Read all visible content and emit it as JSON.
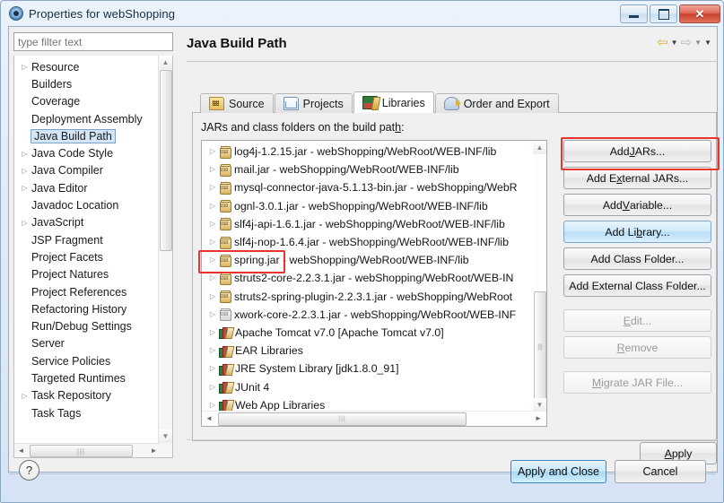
{
  "window": {
    "title": "Properties for webShopping",
    "icon": "properties-gear-icon",
    "controls": {
      "minimize": "minimize",
      "maximize": "maximize",
      "close": "close"
    }
  },
  "filter": {
    "placeholder": "type filter text",
    "value": ""
  },
  "sidebar": {
    "items": [
      {
        "label": "Resource",
        "expandable": true,
        "selected": false
      },
      {
        "label": "Builders",
        "expandable": false,
        "selected": false
      },
      {
        "label": "Coverage",
        "expandable": false,
        "selected": false
      },
      {
        "label": "Deployment Assembly",
        "expandable": false,
        "selected": false
      },
      {
        "label": "Java Build Path",
        "expandable": false,
        "selected": true
      },
      {
        "label": "Java Code Style",
        "expandable": true,
        "selected": false
      },
      {
        "label": "Java Compiler",
        "expandable": true,
        "selected": false
      },
      {
        "label": "Java Editor",
        "expandable": true,
        "selected": false
      },
      {
        "label": "Javadoc Location",
        "expandable": false,
        "selected": false
      },
      {
        "label": "JavaScript",
        "expandable": true,
        "selected": false
      },
      {
        "label": "JSP Fragment",
        "expandable": false,
        "selected": false
      },
      {
        "label": "Project Facets",
        "expandable": false,
        "selected": false
      },
      {
        "label": "Project Natures",
        "expandable": false,
        "selected": false
      },
      {
        "label": "Project References",
        "expandable": false,
        "selected": false
      },
      {
        "label": "Refactoring History",
        "expandable": false,
        "selected": false
      },
      {
        "label": "Run/Debug Settings",
        "expandable": false,
        "selected": false
      },
      {
        "label": "Server",
        "expandable": false,
        "selected": false
      },
      {
        "label": "Service Policies",
        "expandable": false,
        "selected": false
      },
      {
        "label": "Targeted Runtimes",
        "expandable": false,
        "selected": false
      },
      {
        "label": "Task Repository",
        "expandable": true,
        "selected": false
      },
      {
        "label": "Task Tags",
        "expandable": false,
        "selected": false
      }
    ]
  },
  "page": {
    "title": "Java Build Path",
    "nav": {
      "back_icon": "back-arrow-icon",
      "forward_icon": "forward-arrow-icon",
      "menu_icon": "chevron-down-icon"
    }
  },
  "tabs": [
    {
      "label": "Source",
      "icon": "source-folder-icon",
      "active": false
    },
    {
      "label": "Projects",
      "icon": "projects-folder-icon",
      "active": false
    },
    {
      "label": "Libraries",
      "icon": "libraries-books-icon",
      "active": true
    },
    {
      "label": "Order and Export",
      "icon": "order-export-icon",
      "active": false
    }
  ],
  "libraries": {
    "list_label_pre": "JARs and class folders on the build pat",
    "list_label_mnemonic": "h",
    "list_label_post": ":",
    "entries": [
      {
        "label": "log4j-1.2.15.jar - webShopping/WebRoot/WEB-INF/lib",
        "icon": "jar-icon",
        "highlighted": false
      },
      {
        "label": "mail.jar - webShopping/WebRoot/WEB-INF/lib",
        "icon": "jar-icon",
        "highlighted": false
      },
      {
        "label": "mysql-connector-java-5.1.13-bin.jar - webShopping/WebR",
        "icon": "jar-icon",
        "highlighted": false
      },
      {
        "label": "ognl-3.0.1.jar - webShopping/WebRoot/WEB-INF/lib",
        "icon": "jar-icon",
        "highlighted": false
      },
      {
        "label": "slf4j-api-1.6.1.jar - webShopping/WebRoot/WEB-INF/lib",
        "icon": "jar-icon",
        "highlighted": false
      },
      {
        "label": "slf4j-nop-1.6.4.jar - webShopping/WebRoot/WEB-INF/lib",
        "icon": "jar-icon",
        "highlighted": false
      },
      {
        "label": "spring.jar - webShopping/WebRoot/WEB-INF/lib",
        "icon": "jar-icon",
        "highlighted": true
      },
      {
        "label": "struts2-core-2.2.3.1.jar - webShopping/WebRoot/WEB-IN",
        "icon": "jar-icon",
        "highlighted": false
      },
      {
        "label": "struts2-spring-plugin-2.2.3.1.jar - webShopping/WebRoot",
        "icon": "jar-icon",
        "highlighted": false
      },
      {
        "label": "xwork-core-2.2.3.1.jar - webShopping/WebRoot/WEB-INF",
        "icon": "jar-icon-grey",
        "highlighted": false
      },
      {
        "label": "Apache Tomcat v7.0 [Apache Tomcat v7.0]",
        "icon": "library-icon",
        "highlighted": false
      },
      {
        "label": "EAR Libraries",
        "icon": "library-icon",
        "highlighted": false
      },
      {
        "label": "JRE System Library [jdk1.8.0_91]",
        "icon": "library-icon",
        "highlighted": false
      },
      {
        "label": "JUnit 4",
        "icon": "library-icon",
        "highlighted": false
      },
      {
        "label": "Web App Libraries",
        "icon": "library-icon",
        "highlighted": false
      }
    ]
  },
  "buttons": [
    {
      "pre": "Add ",
      "mn": "J",
      "post": "ARs...",
      "state": "highlighted",
      "name": "add-jars-button"
    },
    {
      "pre": "Add E",
      "mn": "x",
      "post": "ternal JARs...",
      "state": "normal",
      "name": "add-external-jars-button"
    },
    {
      "pre": "Add ",
      "mn": "V",
      "post": "ariable...",
      "state": "normal",
      "name": "add-variable-button"
    },
    {
      "pre": "Add Li",
      "mn": "b",
      "post": "rary...",
      "state": "focused",
      "name": "add-library-button"
    },
    {
      "pre": "Add Class Folder...",
      "mn": "",
      "post": "",
      "state": "normal",
      "name": "add-class-folder-button"
    },
    {
      "pre": "Add External Class Folder...",
      "mn": "",
      "post": "",
      "state": "normal",
      "name": "add-external-class-folder-button"
    },
    {
      "pre": "",
      "mn": "E",
      "post": "dit...",
      "state": "disabled",
      "name": "edit-button"
    },
    {
      "pre": "",
      "mn": "R",
      "post": "emove",
      "state": "disabled",
      "name": "remove-button"
    },
    {
      "pre": "",
      "mn": "M",
      "post": "igrate JAR File...",
      "state": "disabled",
      "name": "migrate-jar-file-button"
    }
  ],
  "footer": {
    "apply_pre": "",
    "apply_mn": "A",
    "apply_post": "pply",
    "apply_and_close": "Apply and Close",
    "cancel": "Cancel",
    "help_icon": "help-question-icon",
    "help_glyph": "?"
  },
  "colors": {
    "accent_blue": "#c7e7fb",
    "highlight_red": "#e8352b",
    "selection_blue": "#d3e5f7",
    "close_red": "#c9402c"
  },
  "glyphs": {
    "collapsed_arrow": "▷",
    "up_arrow": "▲",
    "down_arrow": "▼",
    "left_arrow": "◄",
    "right_arrow": "►",
    "back_arrow": "⇦",
    "fwd_arrow": "⇨",
    "caret_down": "▼",
    "grip": "|||",
    "jar_digits": "010"
  }
}
